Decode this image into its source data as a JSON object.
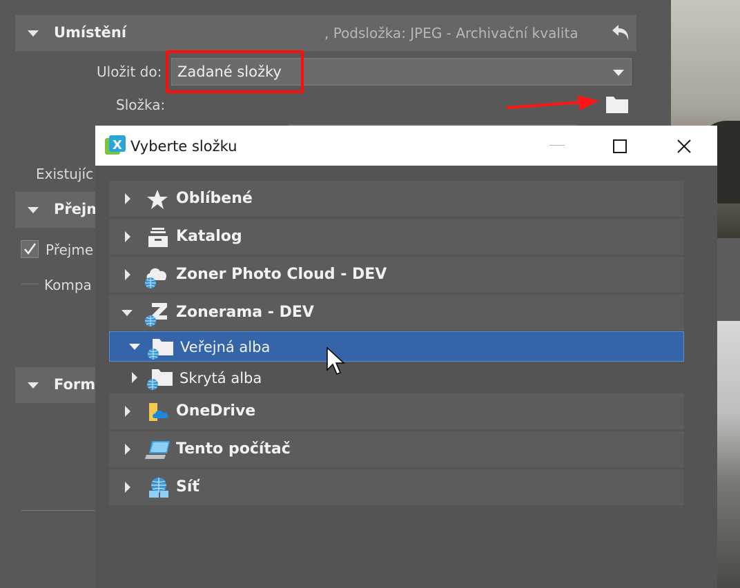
{
  "background": {
    "location_section": {
      "title": "Umístění",
      "summary": ", Podsložka: JPEG - Archivační kvalita",
      "save_to_label": "Uložit do:",
      "save_to_value": "Zadané složky",
      "folder_label": "Složka:",
      "existing_label": "Existujíc"
    },
    "import_section": {
      "title": "Přejm",
      "checkbox_label": "Přejme",
      "compat_label": "Kompa"
    },
    "format_section": {
      "title": "Form"
    }
  },
  "dialog": {
    "title": "Vyberte složku",
    "app_icon": "zoner-app-icon",
    "tree": [
      {
        "label": "Oblíbené",
        "icon": "star-icon",
        "expanded": false
      },
      {
        "label": "Katalog",
        "icon": "catalog-icon",
        "expanded": false
      },
      {
        "label": "Zoner Photo Cloud - DEV",
        "icon": "cloud-icon",
        "expanded": false
      },
      {
        "label": "Zonerama - DEV",
        "icon": "zonerama-icon",
        "expanded": true,
        "children": [
          {
            "label": "Veřejná alba",
            "icon": "folder-web-icon",
            "expanded": true,
            "selected": true
          },
          {
            "label": "Skrytá alba",
            "icon": "folder-web-icon",
            "expanded": false
          }
        ]
      },
      {
        "label": "OneDrive",
        "icon": "onedrive-icon",
        "expanded": false
      },
      {
        "label": "Tento počítač",
        "icon": "computer-icon",
        "expanded": false
      },
      {
        "label": "Síť",
        "icon": "network-icon",
        "expanded": false
      }
    ]
  },
  "colors": {
    "selection": "#3565a8",
    "highlight": "#ff0d0d",
    "panel": "#585858"
  }
}
